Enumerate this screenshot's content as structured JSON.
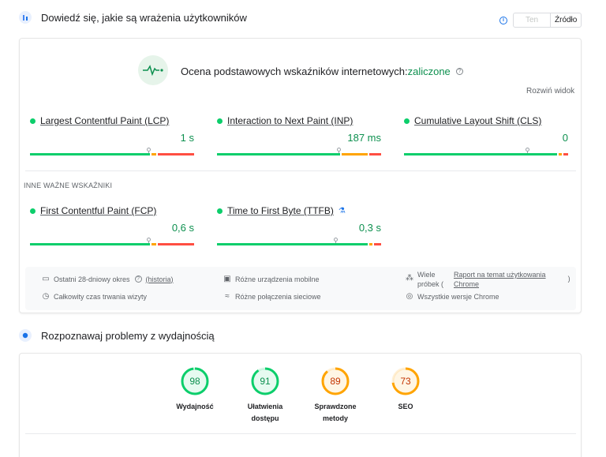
{
  "header": {
    "title": "Dowiedź się, jakie są wrażenia użytkowników",
    "toggle": {
      "off_label": "Ten URL",
      "on_label": "Źródło"
    }
  },
  "cwv": {
    "title_prefix": "Ocena podstawowych wskaźników internetowych:",
    "status": "zaliczone",
    "expand_label": "Rozwiń widok"
  },
  "metrics": [
    {
      "name": "Largest Contentful Paint (LCP)",
      "value": "1 s",
      "position": 0.72,
      "good": 0.74,
      "ni": 0.04
    },
    {
      "name": "Interaction to Next Paint (INP)",
      "value": "187 ms",
      "position": 0.74,
      "good": 0.76,
      "ni": 0.17
    },
    {
      "name": "Cumulative Layout Shift (CLS)",
      "value": "0",
      "position": 0.75,
      "good": 0.94,
      "ni": 0.03
    }
  ],
  "other_label": "INNE WAŻNE WSKAŹNIKI",
  "other_metrics": [
    {
      "name": "First Contentful Paint (FCP)",
      "value": "0,6 s",
      "position": 0.72,
      "good": 0.74,
      "ni": 0.04
    },
    {
      "name": "Time to First Byte (TTFB)",
      "value": "0,3 s",
      "position": 0.72,
      "good": 0.93,
      "ni": 0.03
    }
  ],
  "footer": {
    "period": "Ostatni 28-dniowy okres",
    "history": "(historia)",
    "visit": "Całkowity czas trwania wizyty",
    "devices": "Różne urządzenia mobilne",
    "connections": "Różne połączenia sieciowe",
    "samples_prefix": "Wiele",
    "samples_suffix": "próbek (",
    "report_link_1": "Raport na temat użytkowania",
    "report_link_2": "Chrome",
    "close_paren": ")",
    "chrome_versions": "Wszystkie wersje Chrome"
  },
  "perf": {
    "title": "Rozpoznawaj problemy z wydajnością",
    "scores": [
      {
        "score": "98",
        "value": 98,
        "label1": "Wydajność",
        "label2": "",
        "color": "#0cce6b",
        "text": "#0d904f"
      },
      {
        "score": "91",
        "value": 91,
        "label1": "Ułatwienia",
        "label2": "dostępu",
        "color": "#0cce6b",
        "text": "#0d904f"
      },
      {
        "score": "89",
        "value": 89,
        "label1": "Sprawdzone",
        "label2": "metody",
        "color": "#ffa400",
        "text": "#c33300"
      },
      {
        "score": "73",
        "value": 73,
        "label1": "SEO",
        "label2": "",
        "color": "#ffa400",
        "text": "#c33300"
      }
    ]
  },
  "colors": {
    "good": "#0cce6b",
    "ni": "#ffa400",
    "poor": "#ff4e42"
  },
  "icons": {
    "header": "crux-people-icon",
    "cwv": "pulse-icon",
    "perf": "lighthouse-icon"
  }
}
